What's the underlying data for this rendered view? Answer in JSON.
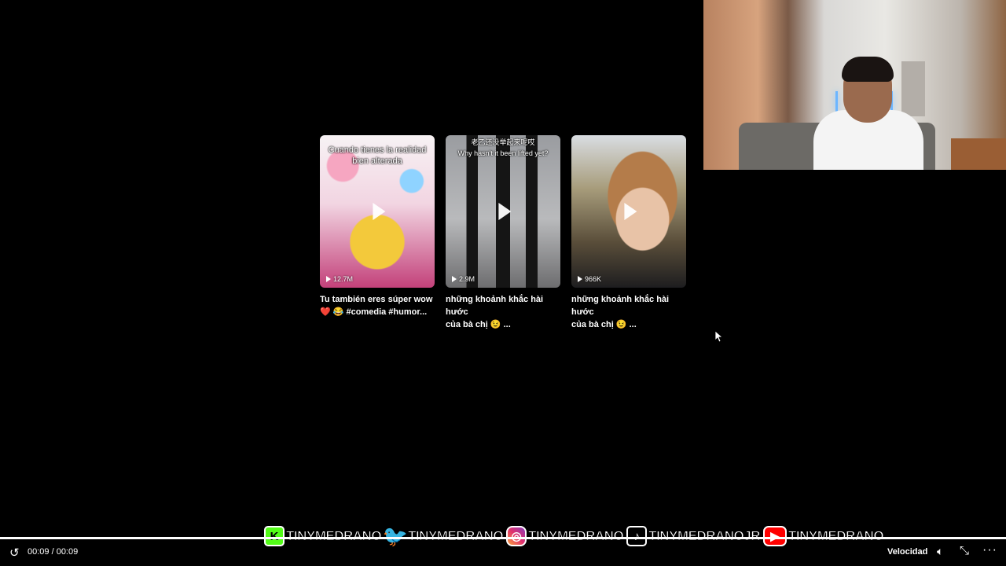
{
  "videos": [
    {
      "overlay": "Cuando tienes la realidad bien alterada",
      "views": "12.7M",
      "title_line1": "Tu también eres súper wow",
      "title_line2": "❤️ 😂 #comedia #humor..."
    },
    {
      "overlay": "老乙还没举起来呢哎\nWhy hasn't it been lifted yet?",
      "views": "2.9M",
      "title_line1": "những khoảnh khắc hài hước",
      "title_line2": "của bà chị 😉 ..."
    },
    {
      "overlay": "",
      "views": "966K",
      "title_line1": "những khoảnh khắc hài hước",
      "title_line2": "của bà chị 😉 ..."
    }
  ],
  "banner": {
    "items": [
      {
        "platform": "kick",
        "icon": "K",
        "name": "TINYMEDRANO"
      },
      {
        "platform": "twitter",
        "icon": "🐦",
        "name": "TINYMEDRANO"
      },
      {
        "platform": "instagram",
        "icon": "◎",
        "name": "TINYMEDRANO"
      },
      {
        "platform": "tiktok",
        "icon": "♪",
        "name": "TINYMEDRANOJR"
      },
      {
        "platform": "youtube",
        "icon": "▶",
        "name": "TINYMEDRANO"
      }
    ]
  },
  "player": {
    "time": "00:09 / 00:09",
    "speed_label": "Velocidad",
    "progress_fraction": 1.0
  },
  "colors": {
    "background": "#000000",
    "kick": "#53fc18",
    "twitter": "#1d9bf0",
    "youtube": "#ff0000"
  }
}
